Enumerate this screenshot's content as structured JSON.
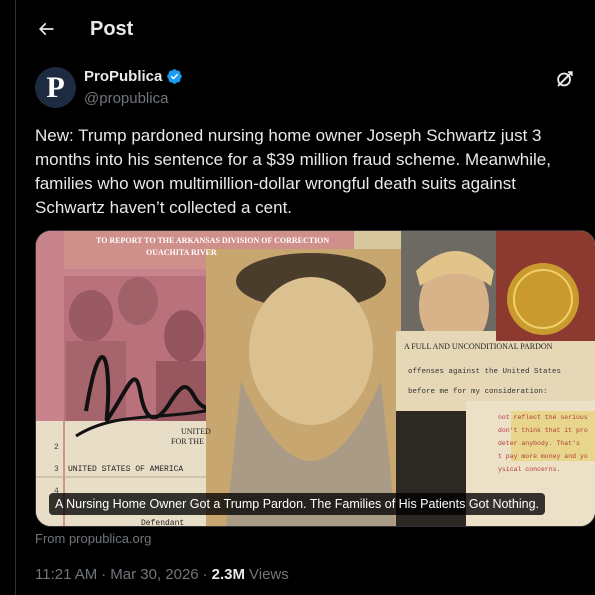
{
  "header": {
    "title": "Post"
  },
  "author": {
    "name": "ProPublica",
    "handle": "@propublica",
    "avatar_letter": "P",
    "verified_color": "#1d9bf0"
  },
  "post": {
    "text": "New: Trump pardoned nursing home owner Joseph Schwartz just 3 months into his sentence for a $39 million fraud scheme. Meanwhile, families who won multimillion-dollar wrongful death suits against Schwartz haven’t collected a cent."
  },
  "media": {
    "caption": "A Nursing Home Owner Got a Trump Pardon. The Families of His Patients Got Nothing.",
    "collage_text": {
      "motion_line1": "TO REPORT TO THE ARKANSAS DIVISION OF CORRECTION",
      "motion_line2": "OUACHITA RIVER",
      "pardon_heading": "A FULL AND UNCONDITIONAL PARDON",
      "pardon_line1": "offenses against the United States",
      "pardon_line2": "before me for my consideration:",
      "court_line": "UNITED STATES OF AMERICA",
      "unite": "UNITED",
      "for_the": "FOR THE",
      "defendant": "Defendant",
      "num_2": "2",
      "num_3": "3",
      "num_4": "4",
      "letter1": "not reflect the serious",
      "letter2": "don't think that it pro",
      "letter3": "deter anybody. That's",
      "letter4": "t pay more money and yo",
      "letter5": "ysical concerns."
    }
  },
  "source": {
    "text": "From propublica.org"
  },
  "meta": {
    "time": "11:21 AM",
    "date": "Mar 30, 2026",
    "views_count": "2.3M",
    "views_label": "Views"
  }
}
